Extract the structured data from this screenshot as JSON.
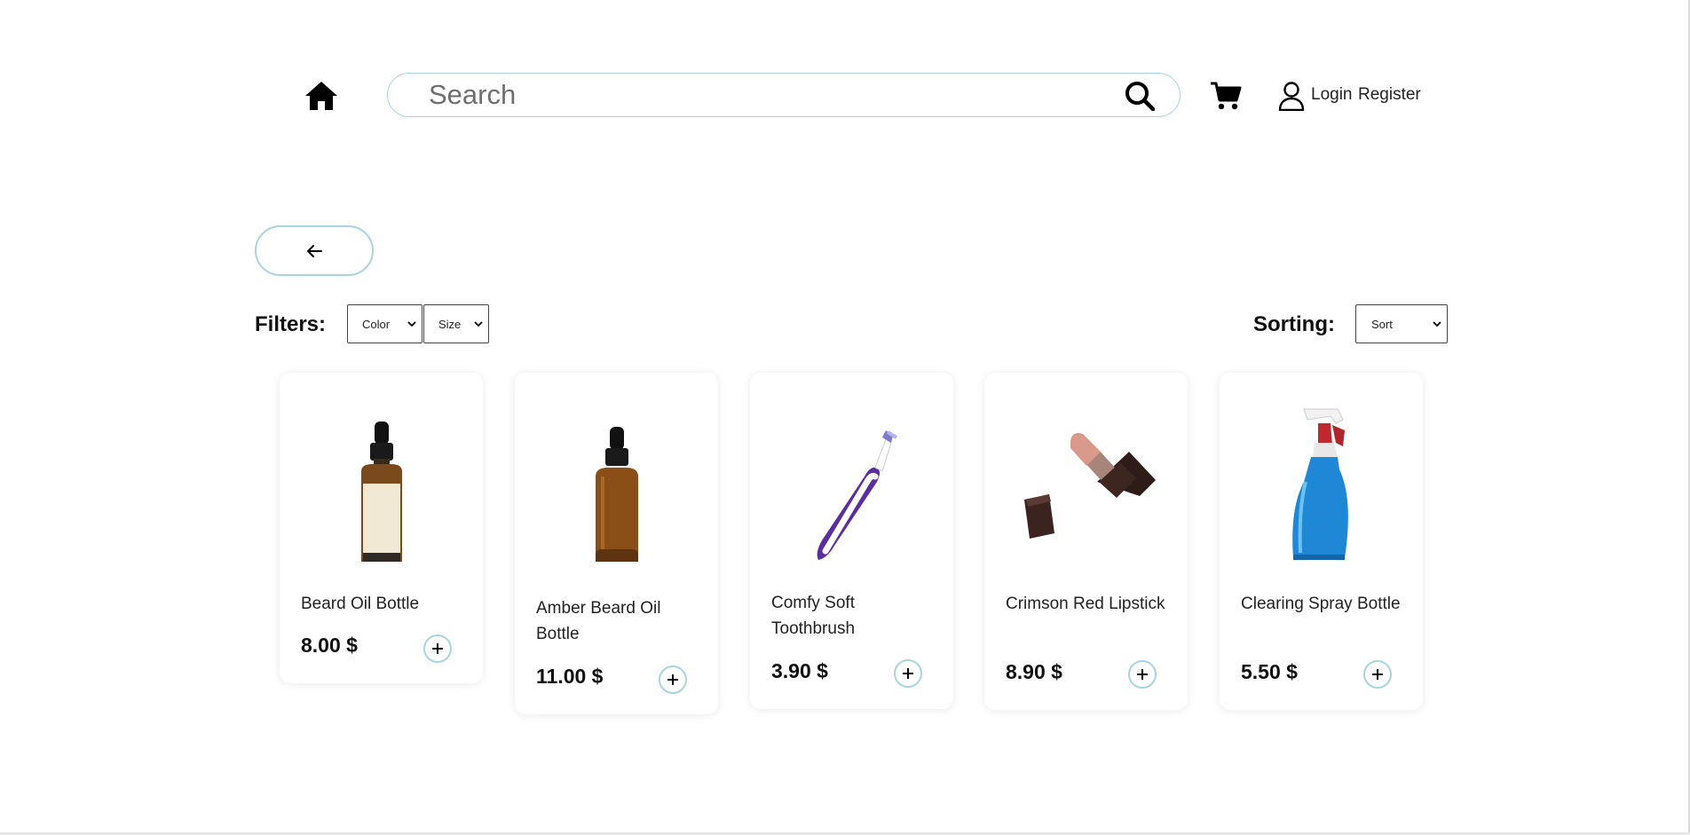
{
  "header": {
    "home_icon": "home-icon",
    "search_placeholder": "Search",
    "search_icon": "search-icon",
    "cart_icon": "cart-icon",
    "user_icon": "user-icon",
    "login_label": "Login",
    "register_label": "Register"
  },
  "back_button": {
    "icon": "arrow-left-icon"
  },
  "filters": {
    "label": "Filters:",
    "color_select": "Color",
    "size_select": "Size"
  },
  "sorting": {
    "label": "Sorting:",
    "sort_select": "Sort"
  },
  "colors": {
    "accent_border": "#a8d4de",
    "text": "#222222"
  },
  "products": [
    {
      "name": "Beard Oil Bottle",
      "price": "8.00 $",
      "image": "amber-dropper-bottle-with-label"
    },
    {
      "name": "Amber Beard Oil Bottle",
      "price": "11.00 $",
      "image": "amber-dropper-bottle"
    },
    {
      "name": "Comfy Soft Toothbrush",
      "price": "3.90 $",
      "image": "purple-toothbrush"
    },
    {
      "name": "Crimson Red Lipstick",
      "price": "8.90 $",
      "image": "lipstick"
    },
    {
      "name": "Clearing Spray Bottle",
      "price": "5.50 $",
      "image": "blue-spray-bottle"
    }
  ]
}
